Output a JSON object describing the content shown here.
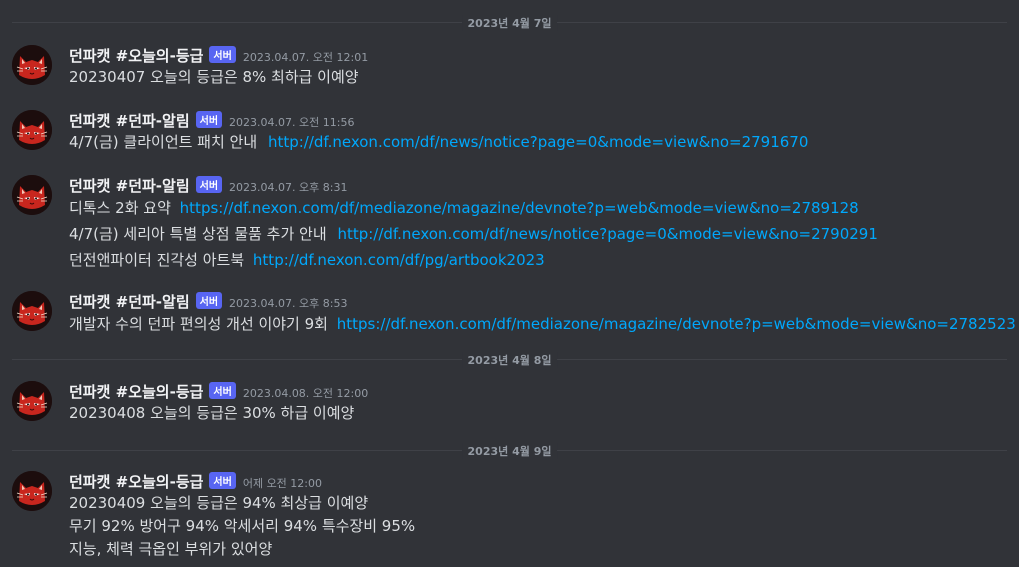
{
  "dividers": {
    "d1": "2023년 4월 7일",
    "d2": "2023년 4월 8일",
    "d3": "2023년 4월 9일"
  },
  "badge": "서버",
  "messages": [
    {
      "author": "던파캣 #오늘의-등급",
      "time": "2023.04.07. 오전 12:01",
      "lines": [
        {
          "text": "20230407 오늘의 등급은 8% 최하급 이예양"
        }
      ]
    },
    {
      "author": "던파캣 #던파-알림",
      "time": "2023.04.07. 오전 11:56",
      "lines": [
        {
          "text": "4/7(금) 클라이언트 패치 안내",
          "link": "http://df.nexon.com/df/news/notice?page=0&mode=view&no=2791670"
        }
      ]
    },
    {
      "author": "던파캣 #던파-알림",
      "time": "2023.04.07. 오후 8:31",
      "lines": [
        {
          "text": "디톡스 2화 요약",
          "link": "https://df.nexon.com/df/mediazone/magazine/devnote?p=web&mode=view&no=2789128"
        },
        {
          "text": "4/7(금) 세리아 특별 상점 물품 추가 안내",
          "link": "http://df.nexon.com/df/news/notice?page=0&mode=view&no=2790291"
        },
        {
          "text": "던전앤파이터 진각성 아트북",
          "link": "http://df.nexon.com/df/pg/artbook2023"
        }
      ]
    },
    {
      "author": "던파캣 #던파-알림",
      "time": "2023.04.07. 오후 8:53",
      "lines": [
        {
          "text": "개발자 수의 던파 편의성 개선 이야기 9회",
          "link": "https://df.nexon.com/df/mediazone/magazine/devnote?p=web&mode=view&no=2782523"
        }
      ]
    },
    {
      "author": "던파캣 #오늘의-등급",
      "time": "2023.04.08. 오전 12:00",
      "lines": [
        {
          "text": "20230408 오늘의 등급은 30% 하급 이예양"
        }
      ]
    },
    {
      "author": "던파캣 #오늘의-등급",
      "time": "어제 오전 12:00",
      "lines": [
        {
          "text": "20230409 오늘의 등급은 94% 최상급 이예양"
        },
        {
          "text": "무기 92% 방어구 94% 악세서리 94% 특수장비 95%"
        },
        {
          "text": "지능, 체력 극옵인 부위가 있어양"
        }
      ]
    }
  ]
}
